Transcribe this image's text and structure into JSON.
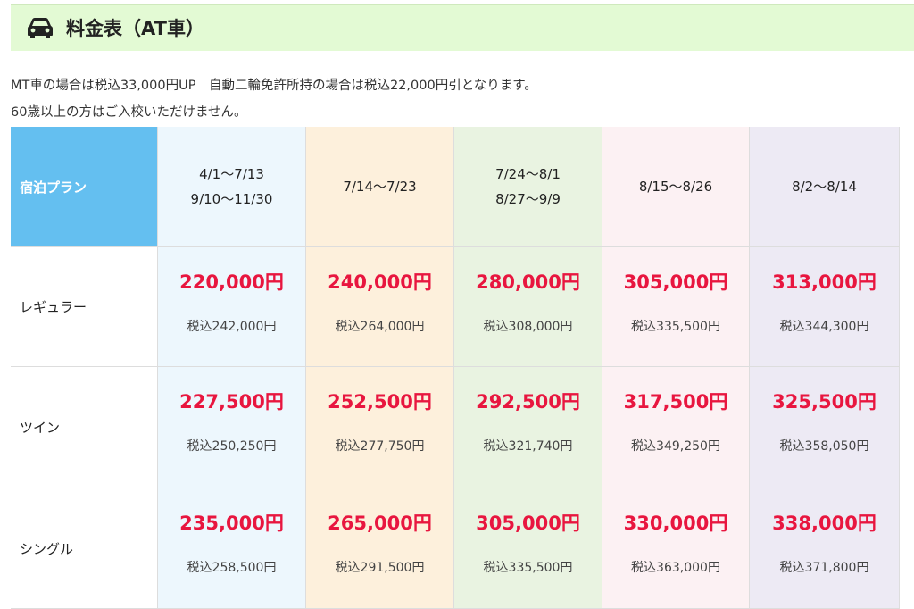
{
  "colors": {
    "title_bg": "#e3fad4",
    "corner_bg": "#64bff0",
    "price_text": "#e8163f",
    "col_1": "#edf7fd",
    "col_2": "#fdf0dc",
    "col_3": "#e9f3e1",
    "col_4": "#fcf1f3",
    "col_5": "#edeaf4"
  },
  "title": {
    "icon": "car-icon",
    "text": "料金表（AT車）"
  },
  "notes": {
    "line1": "MT車の場合は税込33,000円UP　自動二輪免許所持の場合は税込22,000円引となります。",
    "line2": "60歳以上の方はご入校いただけません。"
  },
  "table": {
    "corner": "宿泊プラン",
    "periods": [
      {
        "line1": "4/1〜7/13",
        "line2": "9/10〜11/30"
      },
      {
        "line1": "7/14〜7/23",
        "line2": ""
      },
      {
        "line1": "7/24〜8/1",
        "line2": "8/27〜9/9"
      },
      {
        "line1": "8/15〜8/26",
        "line2": ""
      },
      {
        "line1": "8/2〜8/14",
        "line2": ""
      }
    ],
    "rows": [
      {
        "label": "レギュラー",
        "cells": [
          {
            "price": "220,000円",
            "tax": "税込242,000円"
          },
          {
            "price": "240,000円",
            "tax": "税込264,000円"
          },
          {
            "price": "280,000円",
            "tax": "税込308,000円"
          },
          {
            "price": "305,000円",
            "tax": "税込335,500円"
          },
          {
            "price": "313,000円",
            "tax": "税込344,300円"
          }
        ]
      },
      {
        "label": "ツイン",
        "cells": [
          {
            "price": "227,500円",
            "tax": "税込250,250円"
          },
          {
            "price": "252,500円",
            "tax": "税込277,750円"
          },
          {
            "price": "292,500円",
            "tax": "税込321,740円"
          },
          {
            "price": "317,500円",
            "tax": "税込349,250円"
          },
          {
            "price": "325,500円",
            "tax": "税込358,050円"
          }
        ]
      },
      {
        "label": "シングル",
        "cells": [
          {
            "price": "235,000円",
            "tax": "税込258,500円"
          },
          {
            "price": "265,000円",
            "tax": "税込291,500円"
          },
          {
            "price": "305,000円",
            "tax": "税込335,500円"
          },
          {
            "price": "330,000円",
            "tax": "税込363,000円"
          },
          {
            "price": "338,000円",
            "tax": "税込371,800円"
          }
        ]
      }
    ]
  }
}
